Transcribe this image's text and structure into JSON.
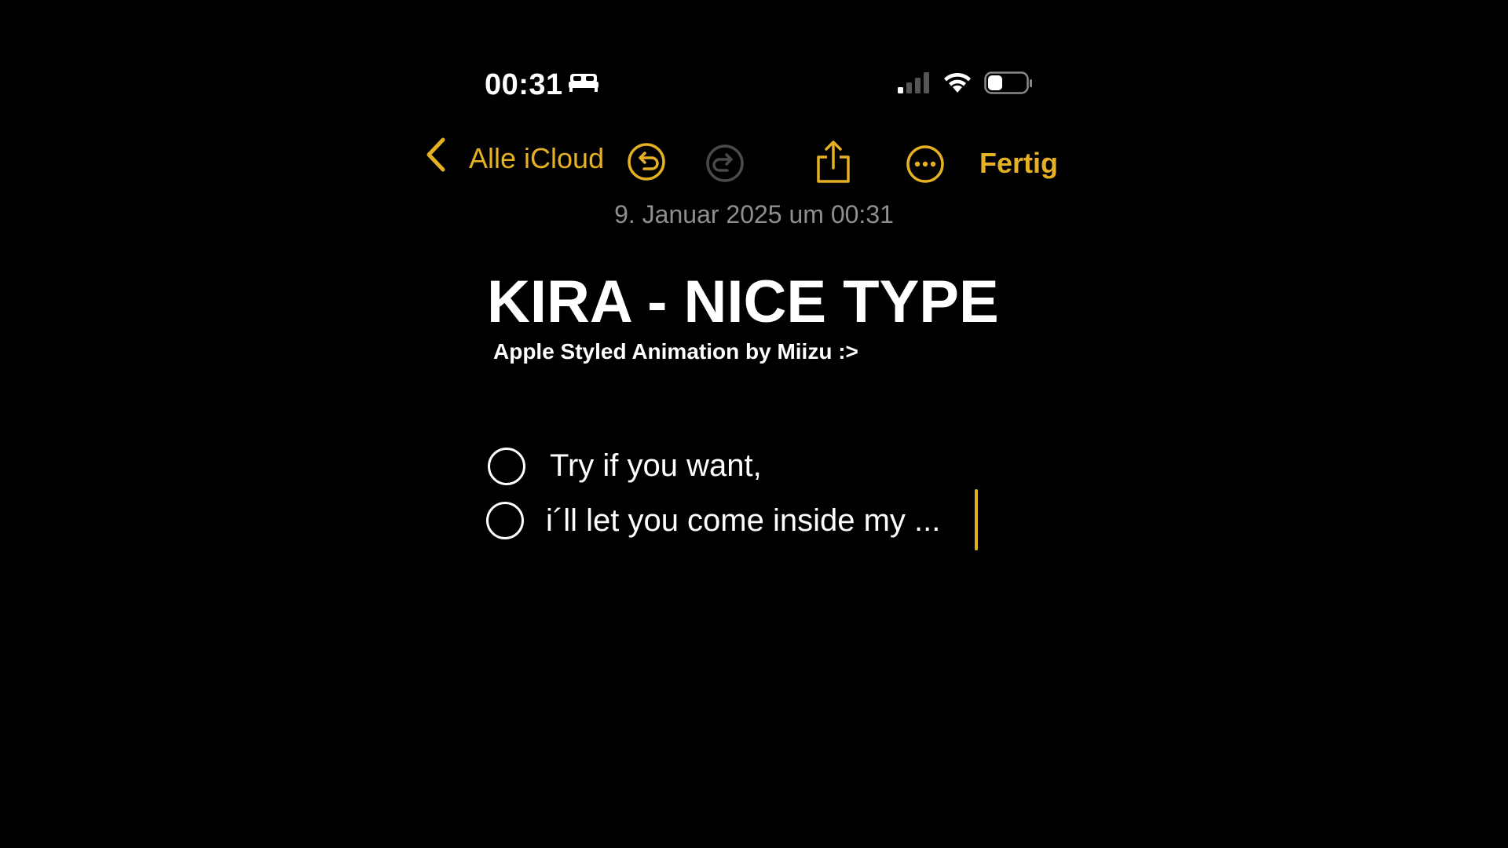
{
  "status_bar": {
    "time": "00:31",
    "icons": [
      "bed-icon",
      "cellular-signal-icon",
      "wifi-icon",
      "battery-icon"
    ]
  },
  "toolbar": {
    "back_label": "Alle iCloud",
    "done_label": "Fertig",
    "icons": [
      "chevron-left-icon",
      "undo-icon",
      "redo-icon",
      "share-icon",
      "more-icon"
    ]
  },
  "note": {
    "date": "9. Januar 2025 um 00:31",
    "title": "KIRA - NICE TYPE",
    "subtitle": "Apple Styled Animation by Miizu :>",
    "checklist": [
      {
        "text": "Try if you want,",
        "checked": false
      },
      {
        "text": "i´ll let you come inside my ...",
        "checked": false
      }
    ]
  },
  "colors": {
    "accent": "#e5b022",
    "background": "#000000",
    "text": "#ffffff",
    "secondary_text": "#8e8e93"
  }
}
